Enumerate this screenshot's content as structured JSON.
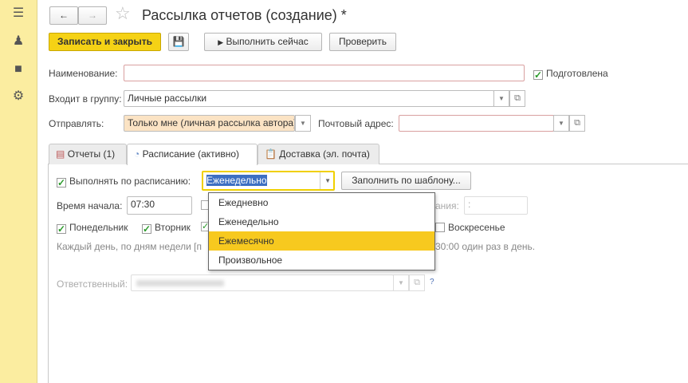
{
  "sidebar": {
    "icons": [
      "menu-icon",
      "users-icon",
      "briefcase-icon",
      "gear-icon"
    ]
  },
  "header": {
    "title": "Рассылка отчетов (создание) *"
  },
  "toolbar": {
    "save_close": "Записать и закрыть",
    "run_now": "Выполнить сейчас",
    "check": "Проверить"
  },
  "form": {
    "name_label": "Наименование:",
    "name_value": "",
    "prepared_label": "Подготовлена",
    "group_label": "Входит в группу:",
    "group_value": "Личные рассылки",
    "send_label": "Отправлять:",
    "send_value": "Только мне (личная рассылка автора)",
    "email_label": "Почтовый адрес:",
    "email_value": ""
  },
  "tabs": [
    {
      "label": "Отчеты (1)"
    },
    {
      "label": "Расписание (активно)"
    },
    {
      "label": "Доставка (эл. почта)"
    }
  ],
  "schedule": {
    "run_label": "Выполнять по расписанию:",
    "period_value": "Еженедельно",
    "fill_template": "Заполнить по шаблону...",
    "start_label": "Время начала:",
    "start_value": "07:30",
    "end_label_partial": "ания:",
    "end_value": ":",
    "days": [
      "Понедельник",
      "Вторник"
    ],
    "sunday": "Воскресенье",
    "summary_left": "Каждый день, по дням недели [п",
    "summary_right": "30:00 один раз в день.",
    "responsible_label": "Ответственный:",
    "help": "?"
  },
  "dropdown": {
    "options": [
      "Ежедневно",
      "Еженедельно",
      "Ежемесячно",
      "Произвольное"
    ],
    "highlighted": "Ежемесячно"
  }
}
